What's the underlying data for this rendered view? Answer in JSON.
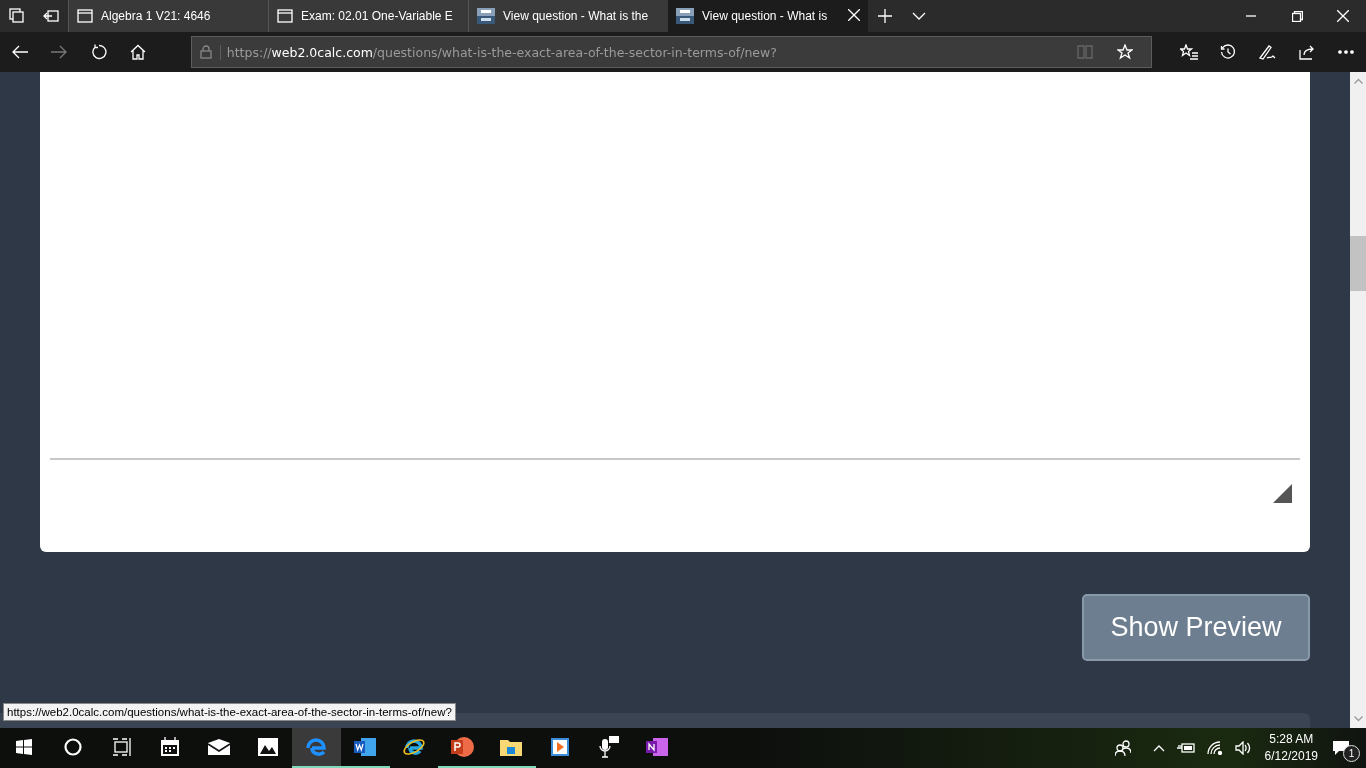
{
  "browser": {
    "tabs": [
      {
        "title": "Algebra 1 V21: 4646",
        "kind": "page",
        "selected": false
      },
      {
        "title": "Exam: 02.01 One-Variable E",
        "kind": "page",
        "selected": false
      },
      {
        "title": "View question - What is the",
        "kind": "calc",
        "selected": false
      },
      {
        "title": "View question - What is",
        "kind": "calc",
        "selected": true
      }
    ],
    "address": {
      "scheme": "https://",
      "host": "web2.0calc.com",
      "path": "/questions/what-is-the-exact-area-of-the-sector-in-terms-of/new?"
    }
  },
  "page": {
    "preview_button": "Show Preview"
  },
  "status_url": "https://web2.0calc.com/questions/what-is-the-exact-area-of-the-sector-in-terms-of/new?",
  "taskbar": {
    "apps": [
      {
        "kind": "start",
        "running": false,
        "selected": false
      },
      {
        "kind": "cortana",
        "running": false,
        "selected": false
      },
      {
        "kind": "taskview",
        "running": false,
        "selected": false
      },
      {
        "kind": "calendar",
        "running": false,
        "selected": false
      },
      {
        "kind": "mail",
        "running": false,
        "selected": false
      },
      {
        "kind": "photos",
        "running": false,
        "selected": false
      },
      {
        "kind": "edge",
        "running": true,
        "selected": true
      },
      {
        "kind": "word",
        "running": true,
        "selected": false
      },
      {
        "kind": "ie",
        "running": false,
        "selected": false
      },
      {
        "kind": "powerpoint",
        "running": true,
        "selected": false
      },
      {
        "kind": "explorer",
        "running": true,
        "selected": false
      },
      {
        "kind": "media",
        "running": false,
        "selected": false
      },
      {
        "kind": "mic",
        "running": false,
        "selected": false
      },
      {
        "kind": "onenote",
        "running": false,
        "selected": false
      }
    ],
    "time": "5:28 AM",
    "date": "6/12/2019",
    "notification_count": "1"
  }
}
